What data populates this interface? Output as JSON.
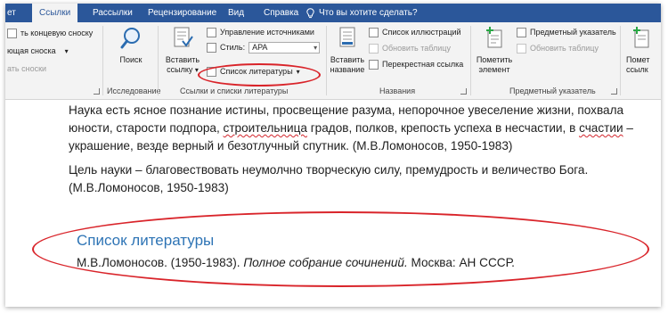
{
  "tabs": [
    {
      "label": "ет"
    },
    {
      "label": "Ссылки",
      "active": true
    },
    {
      "label": "Рассылки"
    },
    {
      "label": "Рецензирование"
    },
    {
      "label": "Вид"
    },
    {
      "label": "Справка"
    }
  ],
  "tell_me": {
    "label": "Что вы хотите сделать?",
    "icon": "lightbulb-icon"
  },
  "ribbon": {
    "footnotes": {
      "insert_endnote": "ть концевую сноску",
      "next_footnote": "ющая сноска",
      "show_notes": "ать сноски"
    },
    "research": {
      "search_label": "Поиск",
      "group_label": "Исследование"
    },
    "citations": {
      "insert_citation": "Вставить ссылку",
      "insert_citation_line1": "Вставить",
      "insert_citation_line2": "ссылку",
      "manage_sources": "Управление источниками",
      "style_label": "Стиль:",
      "style_value": "APA",
      "bibliography": "Список литературы",
      "group_label": "Ссылки и списки литературы"
    },
    "captions": {
      "insert_caption_line1": "Вставить",
      "insert_caption_line2": "название",
      "table_of_figures": "Список иллюстраций",
      "update_table": "Обновить таблицу",
      "cross_reference": "Перекрестная ссылка",
      "group_label": "Названия"
    },
    "index": {
      "mark_entry_line1": "Пометить",
      "mark_entry_line2": "элемент",
      "insert_index": "Предметный указатель",
      "update_index": "Обновить таблицу",
      "group_label": "Предметный указатель"
    },
    "toa": {
      "line1": "Помет",
      "line2": "ссылк"
    }
  },
  "document": {
    "para1": {
      "line1": "Наука есть ясное познание истины, просвещение разума, непорочное увеселение жизни, похвала",
      "line2_a": "юности, старости подпора, ",
      "line2_b": "строительница",
      "line2_c": " градов, полков, крепость успеха в несчастии, в ",
      "line2_d": "счастии",
      "line2_e": " –",
      "line3": "украшение, везде верный и безотлучный спутник. (М.В.Ломоносов, 1950-1983)"
    },
    "para2": {
      "line1": "Цель науки – благовествовать неумолчно творческую силу, премудрость и величество Бога.",
      "line2": "(М.В.Ломоносов, 1950-1983)"
    },
    "bibliography": {
      "heading": "Список литературы",
      "entry_plain_1": "М.В.Ломоносов. (1950-1983). ",
      "entry_italic": "Полное собрание сочинений.",
      "entry_plain_2": " Москва: АН СССР."
    }
  },
  "colors": {
    "tab_bar": "#2b579a",
    "ribbon": "#f3f3f3",
    "heading": "#2e74b5",
    "annotation": "#d9242a",
    "spell_error": "#d2262d"
  }
}
